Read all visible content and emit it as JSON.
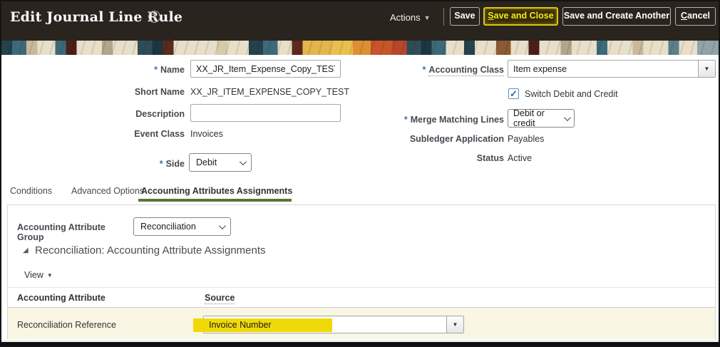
{
  "header": {
    "title": "Edit Journal Line Rule",
    "actions_label": "Actions",
    "buttons": {
      "save": {
        "label": "Save"
      },
      "save_and_close": {
        "key": "S",
        "rest": "ave and Close"
      },
      "save_and_create_another": {
        "label": "Save and Create Another"
      },
      "cancel": {
        "key": "C",
        "rest": "ancel"
      }
    }
  },
  "icons": {
    "help": "?",
    "actions_arrow": "▼",
    "dropdown_arrow": "▼",
    "view_arrow": "▼",
    "disclosure": "◢",
    "check": "✓",
    "required": "*"
  },
  "form": {
    "left": {
      "name_label": "Name",
      "name_value": "XX_JR_Item_Expense_Copy_TEST",
      "short_name_label": "Short Name",
      "short_name_value": "XX_JR_ITEM_EXPENSE_COPY_TEST",
      "description_label": "Description",
      "description_value": "",
      "event_class_label": "Event Class",
      "event_class_value": "Invoices",
      "side_label": "Side",
      "side_value": "Debit"
    },
    "right": {
      "accounting_class_label": "Accounting Class",
      "accounting_class_value": "Item expense",
      "switch_label": "Switch Debit and Credit",
      "merge_label": "Merge Matching Lines",
      "merge_value": "Debit or credit",
      "subledger_label": "Subledger Application",
      "subledger_value": "Payables",
      "status_label": "Status",
      "status_value": "Active"
    }
  },
  "tabs": [
    {
      "label": "Conditions",
      "active": false
    },
    {
      "label": "Advanced Options",
      "active": false
    },
    {
      "label": "Accounting Attributes Assignments",
      "active": true
    }
  ],
  "attributes": {
    "group_label": "Accounting Attribute Group",
    "group_value": "Reconciliation",
    "section_title": "Reconciliation: Accounting Attribute Assignments",
    "view_label": "View",
    "table": {
      "columns": [
        "Accounting Attribute",
        "Source"
      ],
      "rows": [
        {
          "attribute": "Reconciliation Reference",
          "source": "Invoice Number"
        }
      ]
    }
  },
  "colors": {
    "header_bg": "#2a241e",
    "highlight_yellow": "#f0d909",
    "tab_active_underline": "#577839",
    "row_band": "#f9f6e4",
    "required_asterisk": "#3a72a8"
  }
}
